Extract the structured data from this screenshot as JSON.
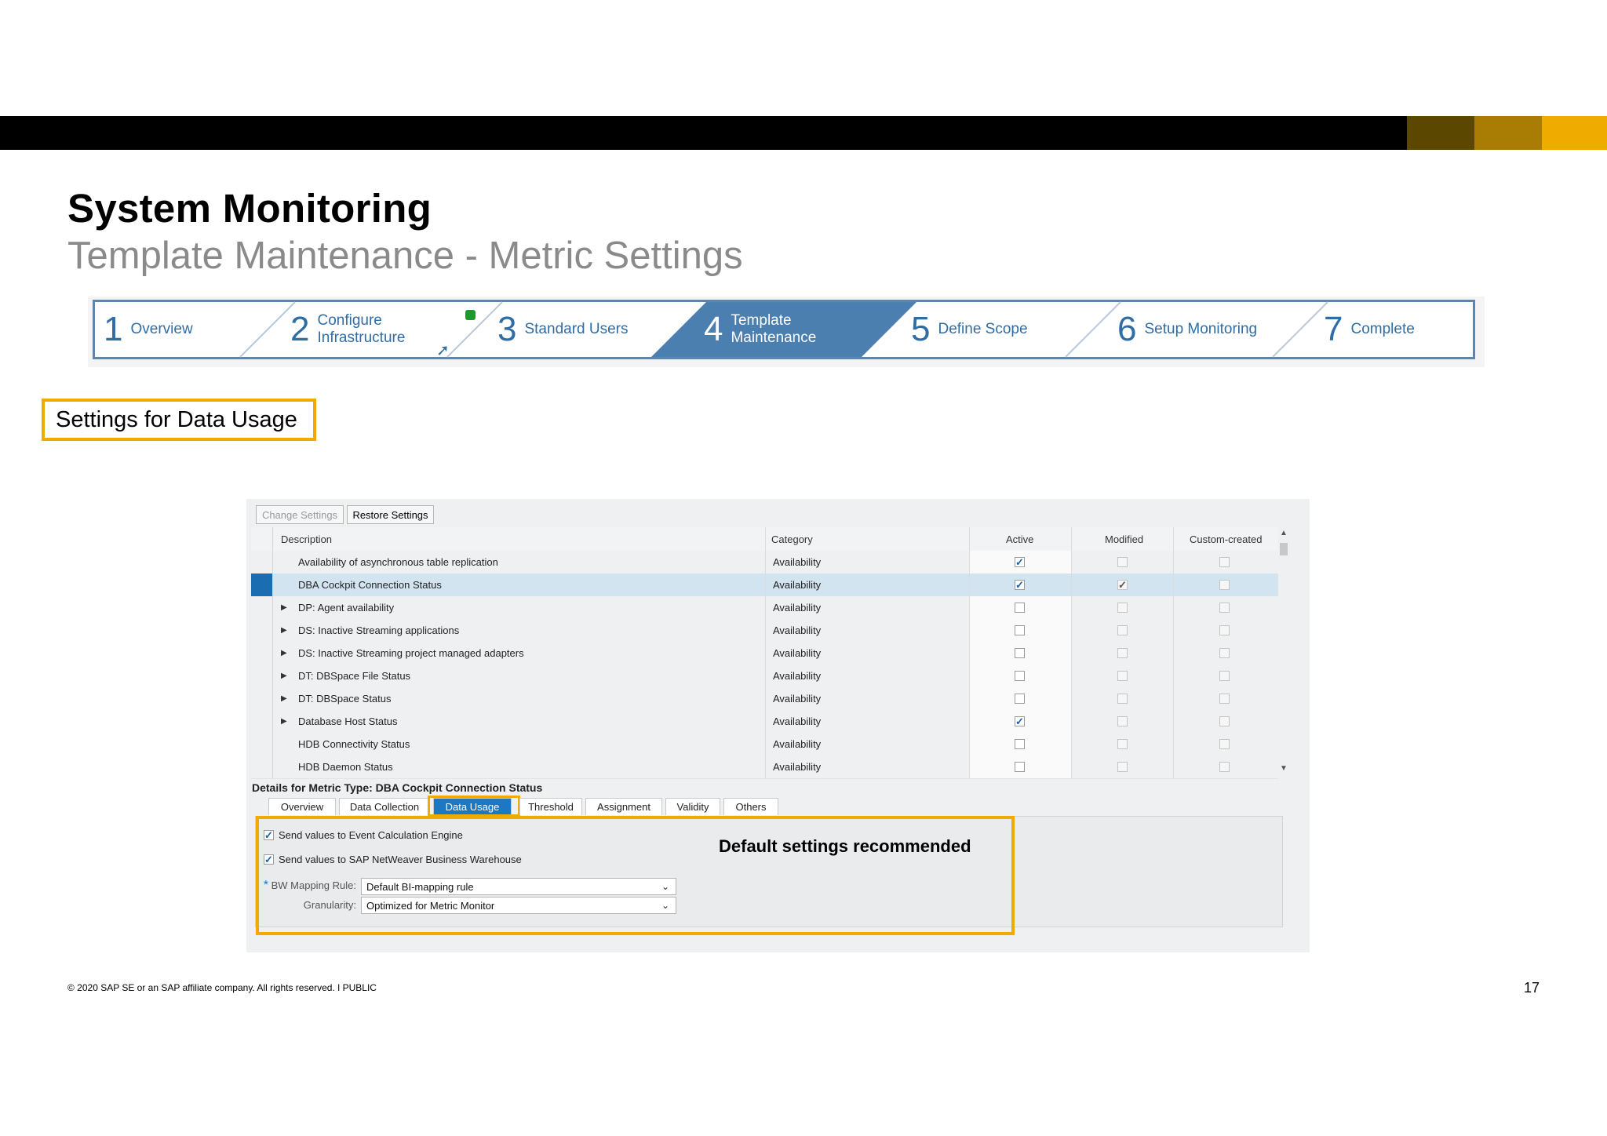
{
  "slide": {
    "title": "System Monitoring",
    "subtitle": "Template Maintenance - Metric Settings",
    "callout": "Settings for Data Usage",
    "footer": "© 2020 SAP SE or an SAP affiliate company. All rights reserved.  ǀ  PUBLIC",
    "page_number": "17",
    "brand_colors": [
      "#5c4700",
      "#a97c03",
      "#efab00"
    ]
  },
  "wizard": {
    "steps": [
      {
        "num": "1",
        "label": "Overview"
      },
      {
        "num": "2",
        "label": "Configure Infrastructure"
      },
      {
        "num": "3",
        "label": "Standard Users"
      },
      {
        "num": "4",
        "label": "Template Maintenance"
      },
      {
        "num": "5",
        "label": "Define Scope"
      },
      {
        "num": "6",
        "label": "Setup Monitoring"
      },
      {
        "num": "7",
        "label": "Complete"
      }
    ],
    "active_step": "4"
  },
  "toolbar": {
    "change_settings": "Change Settings",
    "restore_settings": "Restore Settings"
  },
  "table": {
    "columns": {
      "description": "Description",
      "category": "Category",
      "active": "Active",
      "modified": "Modified",
      "custom": "Custom-created"
    },
    "rows": [
      {
        "description": "Availability of asynchronous table replication",
        "category": "Availability",
        "expandable": false,
        "active": true,
        "modified": false,
        "custom": false,
        "selected": false
      },
      {
        "description": "DBA Cockpit Connection Status",
        "category": "Availability",
        "expandable": false,
        "active": true,
        "modified": true,
        "custom": false,
        "selected": true
      },
      {
        "description": "DP: Agent availability",
        "category": "Availability",
        "expandable": true,
        "active": false,
        "modified": false,
        "custom": false,
        "selected": false
      },
      {
        "description": "DS: Inactive Streaming applications",
        "category": "Availability",
        "expandable": true,
        "active": false,
        "modified": false,
        "custom": false,
        "selected": false
      },
      {
        "description": "DS: Inactive Streaming project managed adapters",
        "category": "Availability",
        "expandable": true,
        "active": false,
        "modified": false,
        "custom": false,
        "selected": false
      },
      {
        "description": "DT: DBSpace File Status",
        "category": "Availability",
        "expandable": true,
        "active": false,
        "modified": false,
        "custom": false,
        "selected": false
      },
      {
        "description": "DT: DBSpace Status",
        "category": "Availability",
        "expandable": true,
        "active": false,
        "modified": false,
        "custom": false,
        "selected": false
      },
      {
        "description": "Database Host Status",
        "category": "Availability",
        "expandable": true,
        "active": true,
        "modified": false,
        "custom": false,
        "selected": false
      },
      {
        "description": "HDB Connectivity Status",
        "category": "Availability",
        "expandable": false,
        "active": false,
        "modified": false,
        "custom": false,
        "selected": false
      },
      {
        "description": "HDB Daemon Status",
        "category": "Availability",
        "expandable": false,
        "active": false,
        "modified": false,
        "custom": false,
        "selected": false
      }
    ]
  },
  "details": {
    "title": "Details for Metric Type: DBA Cockpit Connection Status",
    "tabs": [
      "Overview",
      "Data Collection",
      "Data Usage",
      "Threshold",
      "Assignment",
      "Validity",
      "Others"
    ],
    "active_tab": "Data Usage",
    "options": [
      {
        "label": "Send values to Event Calculation Engine",
        "checked": true
      },
      {
        "label": "Send values to SAP NetWeaver Business Warehouse",
        "checked": true
      }
    ],
    "bw_mapping_label": "BW Mapping Rule:",
    "bw_mapping_value": "Default BI-mapping rule",
    "granularity_label": "Granularity:",
    "granularity_value": "Optimized for Metric Monitor",
    "recommendation": "Default settings recommended"
  }
}
